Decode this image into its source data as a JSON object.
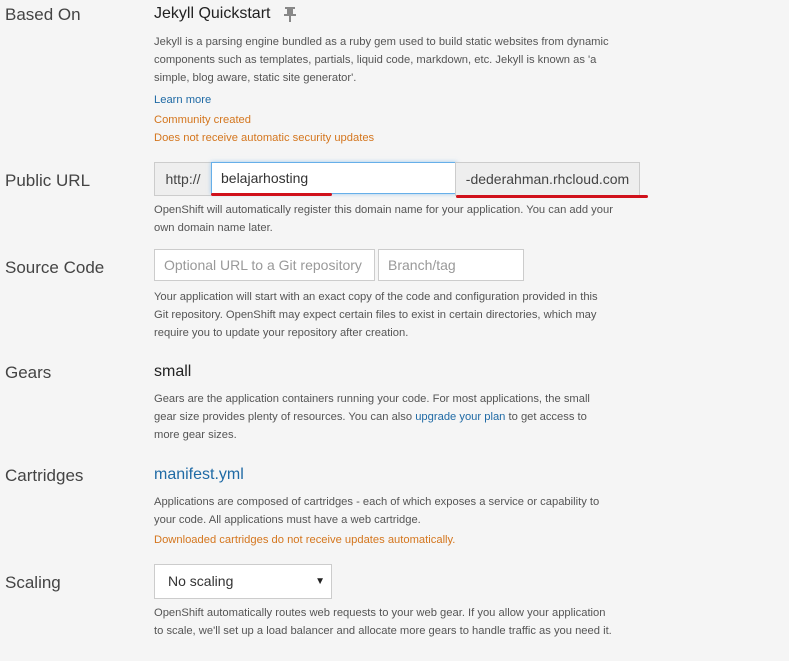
{
  "based_on": {
    "label": "Based On",
    "title": "Jekyll Quickstart",
    "description": "Jekyll is a parsing engine bundled as a ruby gem used to build static websites from dynamic components such as templates, partials, liquid code, markdown, etc. Jekyll is known as 'a simple, blog aware, static site generator'.",
    "learn_more": "Learn more",
    "community": "Community created",
    "no_security": "Does not receive automatic security updates",
    "icon": "pin-icon"
  },
  "public_url": {
    "label": "Public URL",
    "prefix": "http://",
    "value": "belajarhosting",
    "suffix": "-dederahman.rhcloud.com",
    "help": "OpenShift will automatically register this domain name for your application. You can add your own domain name later.",
    "annotation_color": "#d0111b"
  },
  "source_code": {
    "label": "Source Code",
    "url_placeholder": "Optional URL to a Git repository",
    "branch_placeholder": "Branch/tag",
    "help": "Your application will start with an exact copy of the code and configuration provided in this Git repository. OpenShift may expect certain files to exist in certain directories, which may require you to update your repository after creation."
  },
  "gears": {
    "label": "Gears",
    "size": "small",
    "help_before": "Gears are the application containers running your code. For most applications, the small gear size provides plenty of resources. You can also ",
    "help_link": "upgrade your plan",
    "help_after": " to get access to more gear sizes."
  },
  "cartridges": {
    "label": "Cartridges",
    "manifest": "manifest.yml",
    "help": "Applications are composed of cartridges - each of which exposes a service or capability to your code. All applications must have a web cartridge.",
    "warning": "Downloaded cartridges do not receive updates automatically."
  },
  "scaling": {
    "label": "Scaling",
    "selected": "No scaling",
    "help": "OpenShift automatically routes web requests to your web gear. If you allow your application to scale, we'll set up a load balancer and allocate more gears to handle traffic as you need it."
  },
  "colors": {
    "link": "#1f6aa5",
    "warning": "#d4761e",
    "focus": "#66afe9"
  }
}
